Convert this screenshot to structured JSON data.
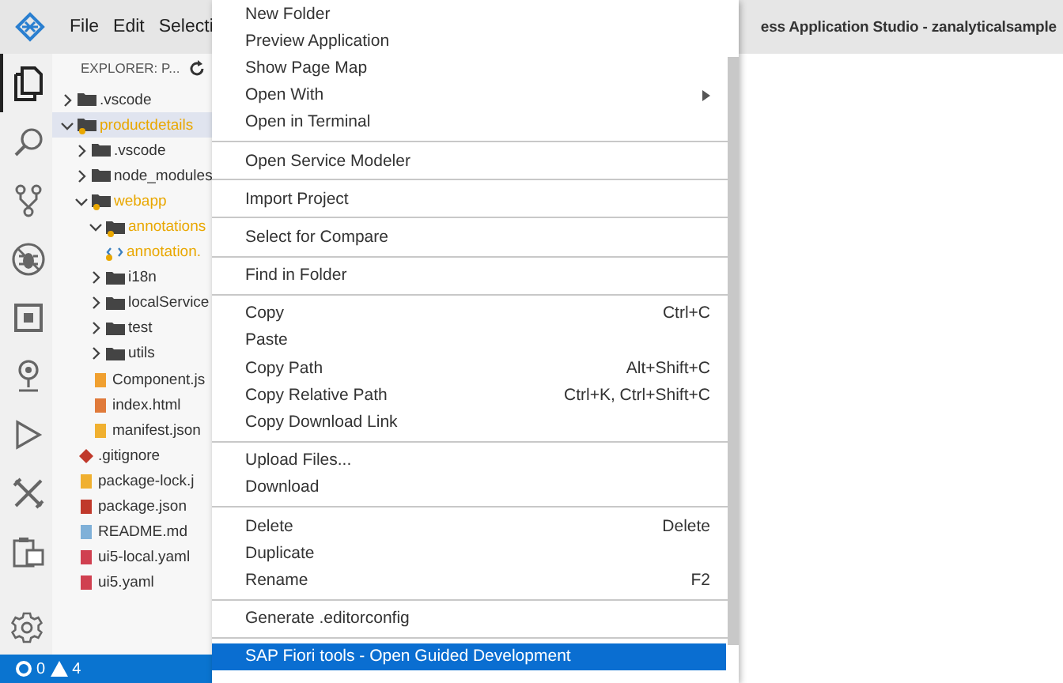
{
  "topbar": {
    "menus": [
      "File",
      "Edit",
      "Selecti"
    ],
    "title": "ess Application Studio - zanalyticalsample"
  },
  "activity_bar": [
    {
      "kind": "files",
      "selected": true
    },
    {
      "kind": "search",
      "selected": false
    },
    {
      "kind": "source-control",
      "selected": false
    },
    {
      "kind": "debug",
      "selected": false
    },
    {
      "kind": "extensions",
      "selected": false
    },
    {
      "kind": "pin",
      "selected": false
    },
    {
      "kind": "run",
      "selected": false
    },
    {
      "kind": "tools",
      "selected": false
    },
    {
      "kind": "clipboard",
      "selected": false
    }
  ],
  "explorer": {
    "title": "EXPLORER: P...",
    "tree": [
      {
        "name": ".vscode",
        "kind": "folder",
        "expanded": false,
        "modified": false,
        "selected": false
      },
      {
        "name": "productdetails",
        "kind": "folder",
        "expanded": true,
        "modified": true,
        "selected": true,
        "children": [
          {
            "name": ".vscode",
            "kind": "folder",
            "expanded": false,
            "modified": false,
            "selected": false
          },
          {
            "name": "node_modules",
            "kind": "folder",
            "expanded": false,
            "modified": false,
            "selected": false
          },
          {
            "name": "webapp",
            "kind": "folder",
            "expanded": true,
            "modified": true,
            "selected": false,
            "children": [
              {
                "name": "annotations",
                "kind": "folder",
                "expanded": true,
                "modified": true,
                "selected": false,
                "children": [
                  {
                    "name": "annotation.",
                    "kind": "xml",
                    "modified": true,
                    "selected": false
                  }
                ]
              },
              {
                "name": "i18n",
                "kind": "folder",
                "expanded": false,
                "modified": false,
                "selected": false
              },
              {
                "name": "localService",
                "kind": "folder",
                "expanded": false,
                "modified": false,
                "selected": false
              },
              {
                "name": "test",
                "kind": "folder",
                "expanded": false,
                "modified": false,
                "selected": false
              },
              {
                "name": "utils",
                "kind": "folder",
                "expanded": false,
                "modified": false,
                "selected": false
              },
              {
                "name": "Component.js",
                "kind": "js",
                "modified": false,
                "selected": false
              },
              {
                "name": "index.html",
                "kind": "html",
                "modified": false,
                "selected": false
              },
              {
                "name": "manifest.json",
                "kind": "json",
                "modified": false,
                "selected": false
              }
            ]
          },
          {
            "name": ".gitignore",
            "kind": "git",
            "modified": false,
            "selected": false
          },
          {
            "name": "package-lock.j",
            "kind": "json",
            "modified": false,
            "selected": false
          },
          {
            "name": "package.json",
            "kind": "package",
            "modified": false,
            "selected": false
          },
          {
            "name": "README.md",
            "kind": "md",
            "modified": false,
            "selected": false
          },
          {
            "name": "ui5-local.yaml",
            "kind": "yaml",
            "modified": false,
            "selected": false
          },
          {
            "name": "ui5.yaml",
            "kind": "yaml",
            "modified": false,
            "selected": false
          }
        ]
      }
    ]
  },
  "context_menu": {
    "groups": [
      [
        {
          "label": "New Folder",
          "selected": false,
          "submenu": false
        },
        {
          "label": "Preview Application",
          "selected": false,
          "submenu": false
        },
        {
          "label": "Show Page Map",
          "selected": false,
          "submenu": false
        },
        {
          "label": "Open With",
          "selected": false,
          "submenu": true
        },
        {
          "label": "Open in Terminal",
          "selected": false,
          "submenu": false
        }
      ],
      [
        {
          "label": "Open Service Modeler",
          "selected": false,
          "submenu": false
        }
      ],
      [
        {
          "label": "Import Project",
          "selected": false,
          "submenu": false
        }
      ],
      [
        {
          "label": "Select for Compare",
          "selected": false,
          "submenu": false
        }
      ],
      [
        {
          "label": "Find in Folder",
          "selected": false,
          "submenu": false
        }
      ],
      [
        {
          "label": "Copy",
          "shortcut": "Ctrl+C",
          "selected": false,
          "submenu": false
        },
        {
          "label": "Paste",
          "selected": false,
          "submenu": false
        },
        {
          "label": "Copy Path",
          "shortcut": "Alt+Shift+C",
          "selected": false,
          "submenu": false
        },
        {
          "label": "Copy Relative Path",
          "shortcut": "Ctrl+K, Ctrl+Shift+C",
          "selected": false,
          "submenu": false
        },
        {
          "label": "Copy Download Link",
          "selected": false,
          "submenu": false
        }
      ],
      [
        {
          "label": "Upload Files...",
          "selected": false,
          "submenu": false
        },
        {
          "label": "Download",
          "selected": false,
          "submenu": false
        }
      ],
      [
        {
          "label": "Delete",
          "shortcut": "Delete",
          "selected": false,
          "submenu": false
        },
        {
          "label": "Duplicate",
          "selected": false,
          "submenu": false
        },
        {
          "label": "Rename",
          "shortcut": "F2",
          "selected": false,
          "submenu": false
        }
      ],
      [
        {
          "label": "Generate .editorconfig",
          "selected": false,
          "submenu": false
        }
      ],
      [
        {
          "label": "SAP Fiori tools - Open Guided Development",
          "selected": true,
          "submenu": false
        }
      ]
    ]
  },
  "status_bar": {
    "errors": "0",
    "warnings": "4"
  }
}
